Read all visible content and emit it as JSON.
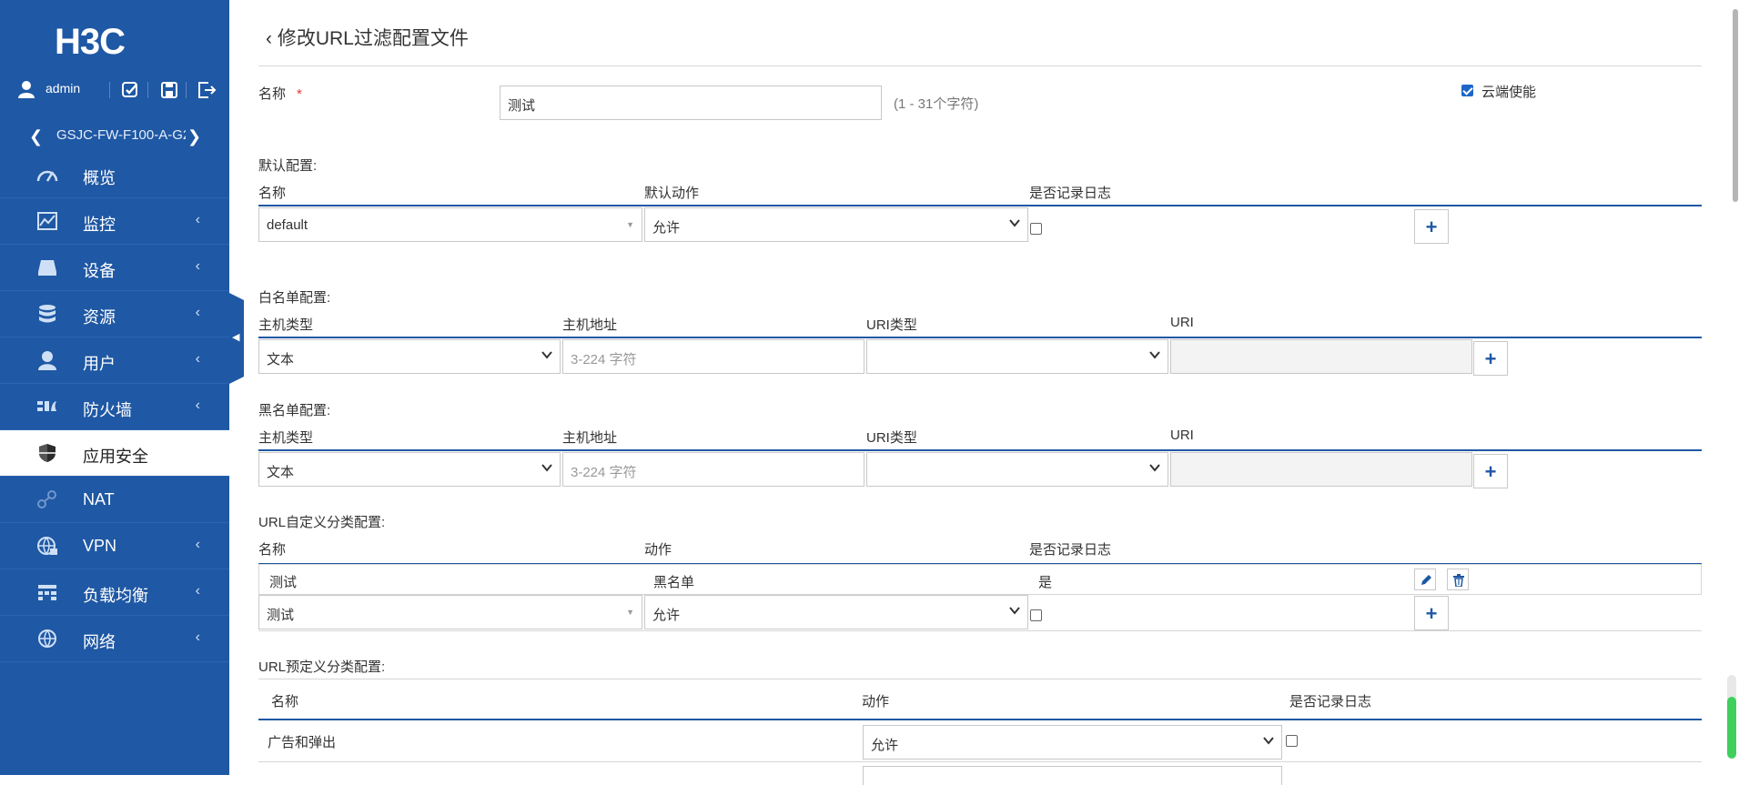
{
  "sidebar": {
    "logo_text": "H3C",
    "user": "admin",
    "device": "GSJC-FW-F100-A-G2",
    "menu": [
      {
        "label": "概览",
        "icon": "dashboard-icon",
        "has_sub": false
      },
      {
        "label": "监控",
        "icon": "monitor-icon",
        "has_sub": true
      },
      {
        "label": "设备",
        "icon": "device-icon",
        "has_sub": true
      },
      {
        "label": "资源",
        "icon": "database-icon",
        "has_sub": true
      },
      {
        "label": "用户",
        "icon": "user-icon",
        "has_sub": true
      },
      {
        "label": "防火墙",
        "icon": "firewall-icon",
        "has_sub": true
      },
      {
        "label": "应用安全",
        "icon": "shield-icon",
        "has_sub": false,
        "active": true
      },
      {
        "label": "NAT",
        "icon": "nat-icon",
        "has_sub": false
      },
      {
        "label": "VPN",
        "icon": "globe-lock-icon",
        "has_sub": true
      },
      {
        "label": "负载均衡",
        "icon": "load-balance-icon",
        "has_sub": true
      },
      {
        "label": "网络",
        "icon": "network-icon",
        "has_sub": true
      }
    ],
    "chevron": "‹"
  },
  "page": {
    "title": "修改URL过滤配置文件",
    "name_label": "名称",
    "required_mark": "*",
    "name_value": "测试",
    "name_hint": "(1 - 31个字符)",
    "cloud_label": "云端使能",
    "cloud_checked": true
  },
  "default_cfg": {
    "section": "默认配置:",
    "col_name": "名称",
    "col_action": "默认动作",
    "col_log": "是否记录日志",
    "name_value": "default",
    "action_value": "允许"
  },
  "whitelist": {
    "section": "白名单配置:",
    "col_host_type": "主机类型",
    "col_host_addr": "主机地址",
    "col_uri_type": "URI类型",
    "col_uri": "URI",
    "host_type": "文本",
    "host_addr_placeholder": "3-224 字符"
  },
  "blacklist": {
    "section": "黑名单配置:",
    "col_host_type": "主机类型",
    "col_host_addr": "主机地址",
    "col_uri_type": "URI类型",
    "col_uri": "URI",
    "host_type": "文本",
    "host_addr_placeholder": "3-224 字符"
  },
  "custom_cat": {
    "section": "URL自定义分类配置:",
    "col_name": "名称",
    "col_action": "动作",
    "col_log": "是否记录日志",
    "row": {
      "name": "测试",
      "action": "黑名单",
      "log": "是"
    },
    "new_name": "测试",
    "new_action": "允许"
  },
  "predef_cat": {
    "section": "URL预定义分类配置:",
    "col_name": "名称",
    "col_action": "动作",
    "col_log": "是否记录日志",
    "rows": [
      {
        "name": "广告和弹出",
        "action": "允许"
      }
    ]
  },
  "plus": "+"
}
